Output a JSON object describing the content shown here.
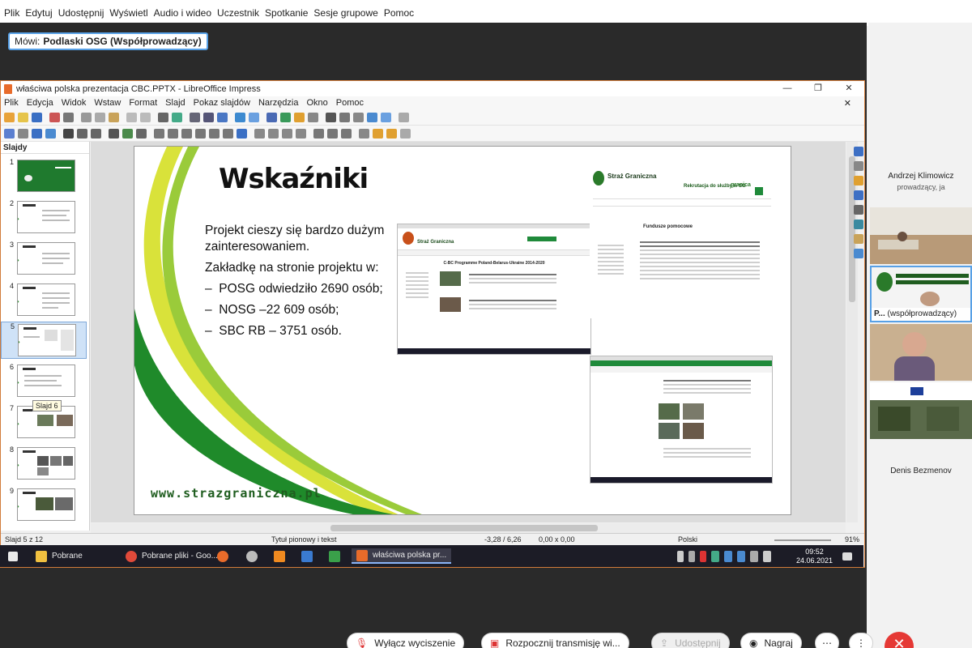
{
  "app_menu": [
    {
      "label": "Plik",
      "key": "P"
    },
    {
      "label": "Edytuj",
      "key": "E"
    },
    {
      "label": "Udostępnij",
      "key": "U"
    },
    {
      "label": "Wyświetl",
      "key": "W"
    },
    {
      "label": "Audio i wideo",
      "key": "A"
    },
    {
      "label": "Uczestnik",
      "key": "U"
    },
    {
      "label": "Spotkanie",
      "key": "p"
    },
    {
      "label": "Sesje grupowe",
      "key": "S"
    },
    {
      "label": "Pomoc",
      "key": "o"
    }
  ],
  "speaker": {
    "prefix": "Mówi:",
    "name": "Podlaski OSG (Współprowadzący)"
  },
  "lo": {
    "title": "właściwa polska prezentacja CBC.PPTX - LibreOffice Impress",
    "menu": [
      "Plik",
      "Edycja",
      "Widok",
      "Wstaw",
      "Format",
      "Slajd",
      "Pokaz slajdów",
      "Narzędzia",
      "Okno",
      "Pomoc"
    ],
    "slides_header": "Slajdy",
    "slide_numbers": [
      "1",
      "2",
      "3",
      "4",
      "5",
      "6",
      "7",
      "8",
      "9"
    ],
    "tooltip": "Slajd 6",
    "status": {
      "slide": "Slajd 5 z 12",
      "layout": "Tytuł pionowy i tekst",
      "position": "-3,28 / 6,26",
      "size": "0,00 x 0,00",
      "language": "Polski",
      "zoom": "91%"
    }
  },
  "slide": {
    "title": "Wskaźniki",
    "intro": "Projekt cieszy się bardzo dużym zainteresowaniem.",
    "lead": "Zakładkę na stronie projektu w:",
    "items": [
      "POSG odwiedziło 2690 osób;",
      "NOSG –22 609 osób;",
      "SBC RB – 3751 osób."
    ],
    "url": "www.strazgraniczna.pl",
    "shot1": {
      "brand": "Straż Graniczna",
      "heading": "C-BC Programme Poland-Belarus-Ukraine 2014-2020"
    },
    "shot2": {
      "brand": "Straż Graniczna",
      "tagline": "Rekrutacja do służby w SG",
      "portal": "granica",
      "heading": "Fundusze pomocowe"
    }
  },
  "taskbar": {
    "items": [
      "Pobrane",
      "Pobrane pliki - Goo...",
      "właściwa polska pr..."
    ],
    "time": "09:52",
    "date": "24.06.2021"
  },
  "participants": [
    {
      "name": "Andrzej Klimowicz",
      "role": "prowadzący, ja"
    },
    {
      "label_bold": "P...",
      "label_rest": "(współprowadzący)"
    },
    {
      "name": "Denis Bezmenov"
    }
  ],
  "controls": {
    "mute": "Wyłącz wyciszenie",
    "stream": "Rozpocznij transmisję wi...",
    "share": "Udostępnij",
    "record": "Nagraj"
  },
  "colors": {
    "accent_green": "#1f8a3a",
    "end_red": "#e53935",
    "speaker_border": "#57a0e6",
    "lo_border": "#d17b3a"
  }
}
